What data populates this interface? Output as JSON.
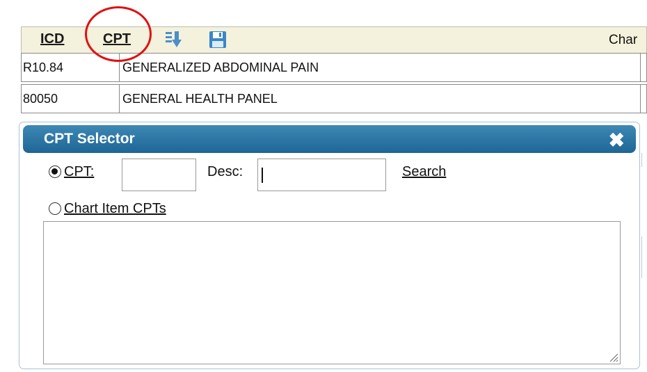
{
  "header": {
    "icd_label": "ICD",
    "cpt_label": "CPT",
    "right_label": "Char",
    "icons": [
      "import-icon",
      "save-icon"
    ]
  },
  "rows": [
    {
      "code": "R10.84",
      "description": "GENERALIZED ABDOMINAL PAIN"
    },
    {
      "code": "80050",
      "description": "GENERAL HEALTH PANEL"
    }
  ],
  "dialog": {
    "title": "CPT Selector",
    "close_glyph": "✖",
    "cpt_label": "CPT:",
    "cpt_value": "",
    "desc_label": "Desc:",
    "desc_value": "",
    "search_label": "Search",
    "chart_item_label": "Chart Item CPTs",
    "selected_option": "CPT:",
    "results_text": ""
  },
  "colors": {
    "header_bg": "#f4f1dc",
    "dialog_title_bg": "#2a77a6",
    "highlight_circle": "#e01010"
  }
}
